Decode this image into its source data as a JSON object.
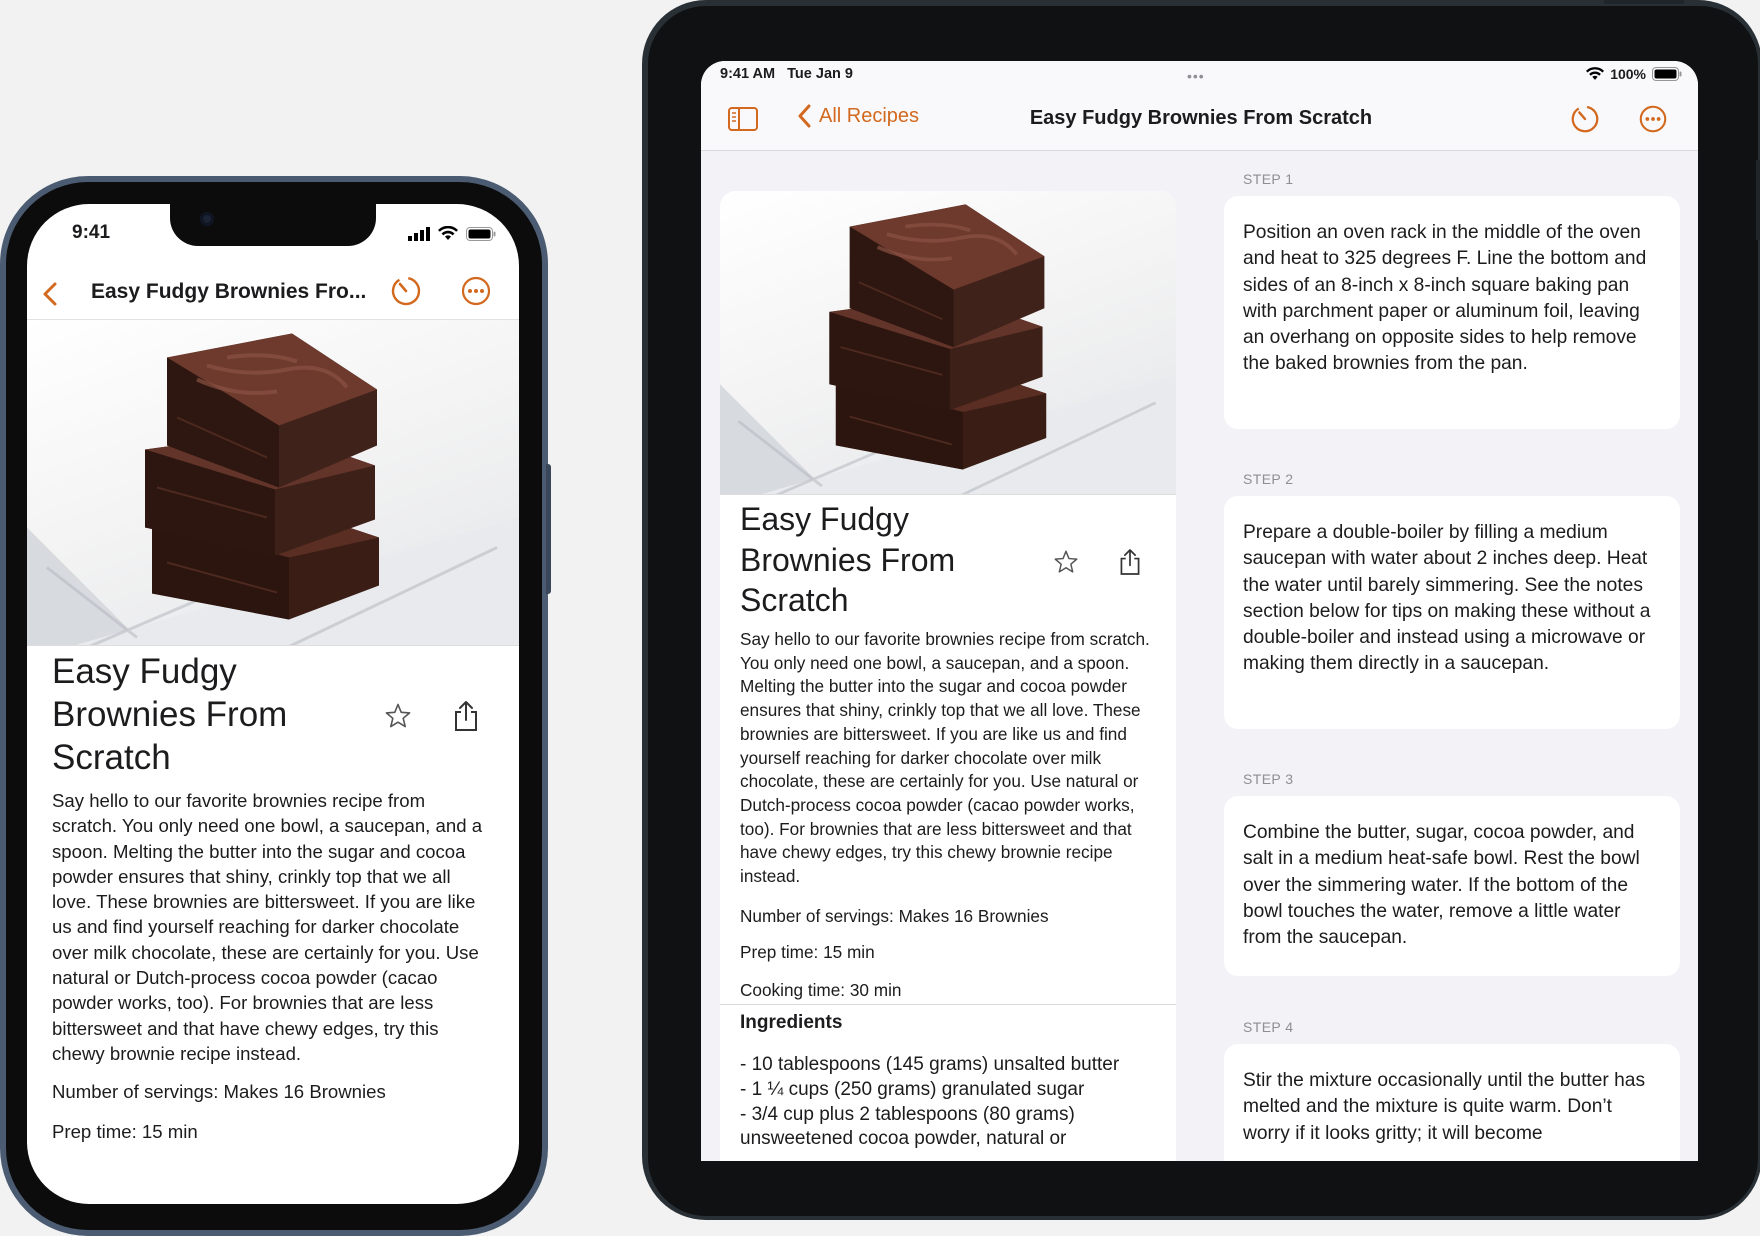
{
  "recipe": {
    "title": "Easy Fudgy Brownies From Scratch",
    "title_truncated": "Easy Fudgy Brownies Fro...",
    "description": "Say hello to our favorite brownies recipe from scratch. You only need one bowl, a saucepan, and a spoon. Melting the butter into the sugar and cocoa powder ensures that shiny, crinkly top that we all love. These brownies are bittersweet. If you are like us and find yourself reaching for darker chocolate over milk chocolate, these are certainly for you. Use natural or Dutch-process cocoa powder (cacao powder works, too). For brownies that are less bittersweet and that have chewy edges, try this chewy brownie recipe instead.",
    "servings": "Number of servings: Makes 16 Brownies",
    "prep_time": "Prep time: 15 min",
    "cooking_time": "Cooking time: 30 min",
    "ingredients_heading": "Ingredients",
    "ingredients": [
      "- 10 tablespoons (145 grams) unsalted butter",
      "- 1 ¼ cups (250 grams) granulated sugar",
      "- 3/4 cup plus 2 tablespoons (80 grams)",
      "unsweetened cocoa powder, natural or"
    ]
  },
  "phone": {
    "status_time": "9:41"
  },
  "ipad": {
    "status_time": "9:41 AM   Tue Jan 9",
    "status_dots": "•••",
    "battery": "100%",
    "back_label": "All Recipes"
  },
  "steps": [
    {
      "label": "STEP 1",
      "text": "Position an oven rack in the middle of the oven and heat to 325 degrees F. Line the bottom and sides of an 8-inch x 8-inch square baking pan with parchment paper or aluminum foil, leaving an overhang on opposite sides to help remove the baked brownies from the pan."
    },
    {
      "label": "STEP 2",
      "text": "Prepare a double-boiler by filling a medium saucepan with water about 2 inches deep. Heat the water until barely simmering. See the notes section below for tips on making these without a double-boiler and instead using a microwave or making them directly in a saucepan."
    },
    {
      "label": "STEP 3",
      "text": "Combine the butter, sugar, cocoa powder, and salt in a medium heat-safe bowl. Rest the bowl over the simmering water. If the bottom of the bowl touches the water, remove a little water from the saucepan."
    },
    {
      "label": "STEP 4",
      "text": "Stir the mixture occasionally until the butter has melted and the mixture is quite warm. Don’t worry if it looks gritty; it will become"
    }
  ],
  "colors": {
    "accent": "#D2691E",
    "iphone_frame": "#4B5B72",
    "ipad_frame": "#283036"
  },
  "icons": [
    "chevron-left-icon",
    "timer-icon",
    "more-icon",
    "star-icon",
    "share-icon",
    "sidebar-icon",
    "wifi-icon",
    "battery-icon",
    "cellular-icon"
  ]
}
